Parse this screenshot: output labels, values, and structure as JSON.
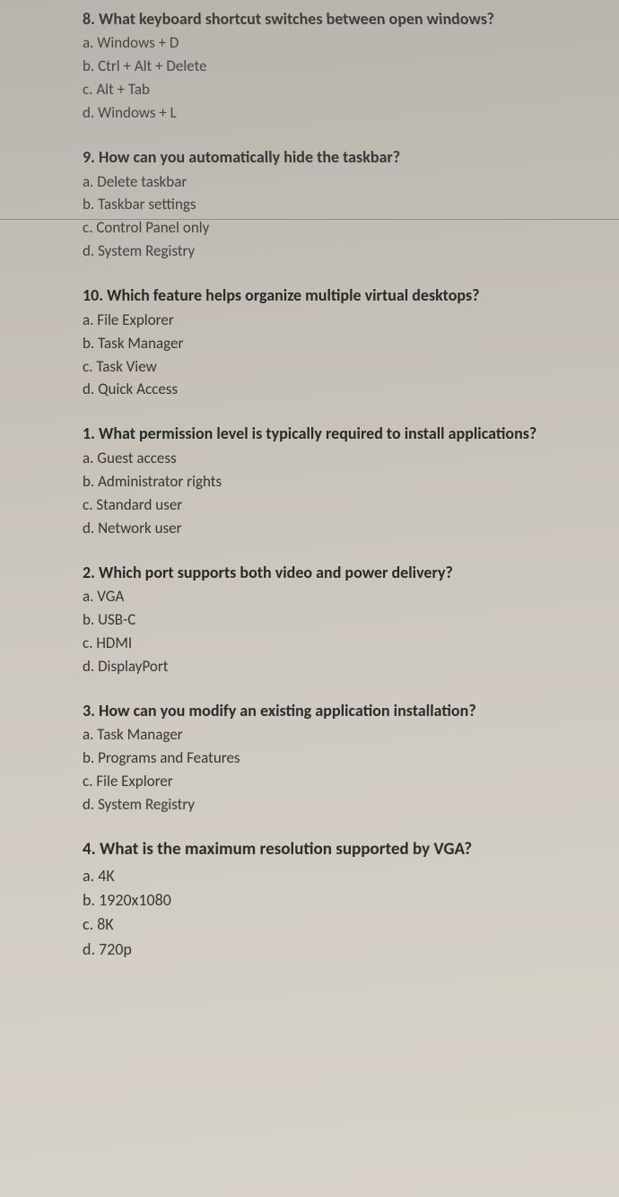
{
  "questions": [
    {
      "number": "8.",
      "text": "What keyboard shortcut switches between open windows?",
      "options": {
        "a": "Windows + D",
        "b": "Ctrl + Alt + Delete",
        "c": "Alt + Tab",
        "d": "Windows + L"
      }
    },
    {
      "number": "9.",
      "text": "How can you automatically hide the taskbar?",
      "options": {
        "a": "Delete taskbar",
        "b": "Taskbar settings",
        "c": "Control Panel only",
        "d": "System Registry"
      }
    },
    {
      "number": "10.",
      "text": "Which feature helps organize multiple virtual desktops?",
      "options": {
        "a": "File Explorer",
        "b": "Task Manager",
        "c": "Task View",
        "d": "Quick Access"
      }
    },
    {
      "number": "1.",
      "text": "What permission level is typically required to install applications?",
      "options": {
        "a": "Guest access",
        "b": "Administrator rights",
        "c": "Standard user",
        "d": "Network user"
      }
    },
    {
      "number": "2.",
      "text": "Which port supports both video and power delivery?",
      "options": {
        "a": "VGA",
        "b": "USB-C",
        "c": "HDMI",
        "d": "DisplayPort"
      }
    },
    {
      "number": "3.",
      "text": "How can you modify an existing application installation?",
      "options": {
        "a": "Task Manager",
        "b": "Programs and Features",
        "c": "File Explorer",
        "d": "System Registry"
      }
    },
    {
      "number": "4.",
      "text": "What is the maximum resolution supported by VGA?",
      "options": {
        "a": "4K",
        "b": "1920x1080",
        "c": "8K",
        "d": "720p"
      }
    }
  ]
}
